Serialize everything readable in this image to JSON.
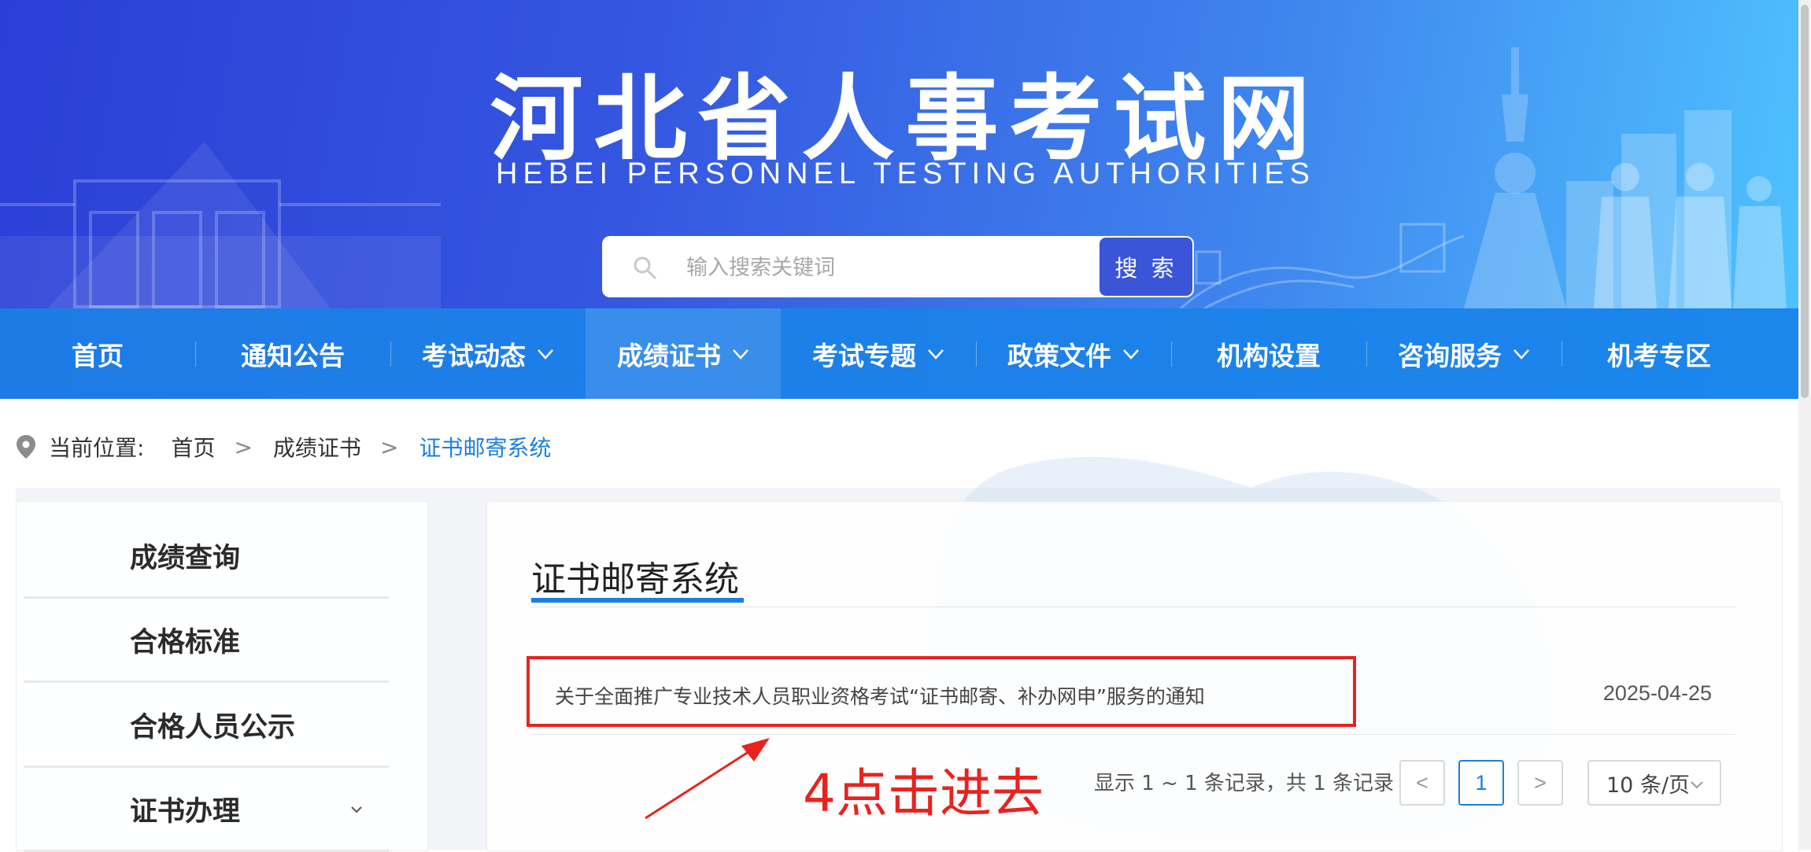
{
  "header": {
    "title": "河北省人事考试网",
    "subtitle": "HEBEI PERSONNEL TESTING AUTHORITIES"
  },
  "search": {
    "placeholder": "输入搜索关键词",
    "button_label": "搜 索",
    "icon": "search-icon"
  },
  "nav": {
    "items": [
      {
        "label": "首页",
        "has_dropdown": false
      },
      {
        "label": "通知公告",
        "has_dropdown": false
      },
      {
        "label": "考试动态",
        "has_dropdown": true
      },
      {
        "label": "成绩证书",
        "has_dropdown": true,
        "active": true
      },
      {
        "label": "考试专题",
        "has_dropdown": true
      },
      {
        "label": "政策文件",
        "has_dropdown": true
      },
      {
        "label": "机构设置",
        "has_dropdown": false
      },
      {
        "label": "咨询服务",
        "has_dropdown": true
      },
      {
        "label": "机考专区",
        "has_dropdown": false
      }
    ]
  },
  "breadcrumb": {
    "label": "当前位置:",
    "items": [
      "首页",
      "成绩证书",
      "证书邮寄系统"
    ],
    "separator": ">"
  },
  "sidebar": {
    "items": [
      {
        "label": "成绩查询"
      },
      {
        "label": "合格标准"
      },
      {
        "label": "合格人员公示"
      },
      {
        "label": "证书办理",
        "has_dropdown": true
      }
    ]
  },
  "main": {
    "title": "证书邮寄系统",
    "notices": [
      {
        "title": "关于全面推广专业技术人员职业资格考试“证书邮寄、补办网申”服务的通知",
        "date": "2025-04-25"
      }
    ],
    "pagination": {
      "info": "显示 1 ~ 1 条记录，共 1 条记录",
      "prev": "<",
      "current_page": "1",
      "next": ">",
      "page_size": "10 条/页"
    }
  },
  "annotation": {
    "text": "4点击进去",
    "color": "#e8231f"
  },
  "colors": {
    "nav_bg": "#1b80e8",
    "accent": "#1a7fe0",
    "annotation": "#e8231f"
  }
}
